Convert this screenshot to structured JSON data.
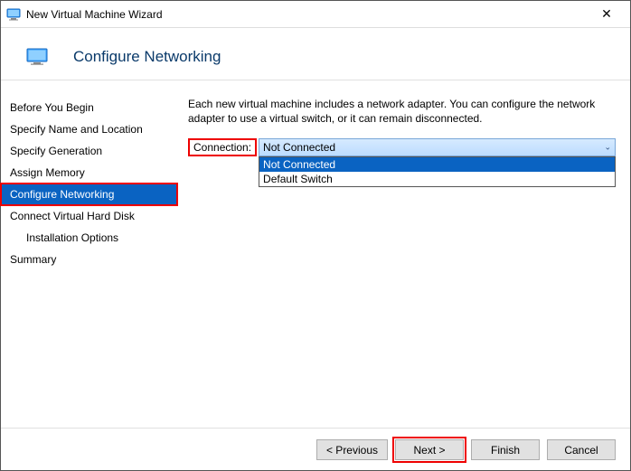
{
  "window": {
    "title": "New Virtual Machine Wizard"
  },
  "header": {
    "section_title": "Configure Networking"
  },
  "steps": {
    "items": [
      {
        "label": "Before You Begin"
      },
      {
        "label": "Specify Name and Location"
      },
      {
        "label": "Specify Generation"
      },
      {
        "label": "Assign Memory"
      },
      {
        "label": "Configure Networking"
      },
      {
        "label": "Connect Virtual Hard Disk"
      },
      {
        "label": "Installation Options"
      },
      {
        "label": "Summary"
      }
    ]
  },
  "main": {
    "description": "Each new virtual machine includes a network adapter. You can configure the network adapter to use a virtual switch, or it can remain disconnected.",
    "connection_label": "Connection:",
    "connection_value": "Not Connected",
    "options": [
      "Not Connected",
      "Default Switch"
    ]
  },
  "footer": {
    "previous": "< Previous",
    "next": "Next >",
    "finish": "Finish",
    "cancel": "Cancel"
  }
}
